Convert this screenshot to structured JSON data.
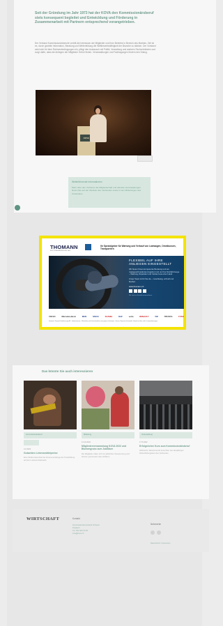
{
  "article": {
    "lead": "Seit der Gründung im Jahr 1973 hat der KOVA den Kommissionärsberuf stets konsequent begleitet und Entwicklung und Förderung in Zusammenarbeit mit Partnern entsprechend vorangetrieben.",
    "body": "Der Verband Kommissionärsberufe vertritt die Interessen der Mitglieder und ihrer Betriebe in Bereich des Marktes. Ziel ist es, durch gezielte Information, Beratung und Weiterbildung die Wettbewerbsfähigkeit der Branche zu stärken. Der Vorstand setzt sich für faire Rahmenbedingungen ein, pflegt den Austausch mit Politik, Verwaltung und anderen Fachverbänden und sorgt dafür, dass die Anliegen der Mitglieder Gehör finden. Veranstaltungen und Fachtagungen fördern den Dialog.",
    "photo_label": "KOVA",
    "info_box": {
      "title": "Weiterführende Informationen",
      "text": "Mehr über den Verband, die Mitgliedschaft und aktuelle Veranstaltungen finden Sie auf der Website des Verbandes sowie in den Mitteilungen des Vorstandes."
    }
  },
  "ad": {
    "logo": "THOMANN",
    "logo_sub": "NUTZFAHRZEUGE AG",
    "tagline": "Ihr Spezialgeber für Wartung und Verkauf von Lastwagen, Omnibussen, Transportern",
    "panel_title": "FLEXIBEL AUF IHRE ANLIEGEN EINGESTELLT",
    "panel_text": "Wir bieten Ihnen kompetente Beratung und ein massgeschneidertes Angebot rund um Ihre Nutzfahrzeuge – Wartung, Reparatur und Verkauf aus einer Hand.",
    "panel_text2": "Unser Team ist für Sie da – zuverlässig, schnell und flexibel.",
    "url": "www.thomann.ch",
    "footnote": "Wir sind ein Familienunternehmen",
    "brands": [
      "VOLVO",
      "Mercedes-Benz",
      "MAN",
      "IVECO",
      "SCANIA",
      "DAF",
      "setra",
      "RENAULT",
      "VW",
      "TRUCKS",
      "FUSO"
    ],
    "legal": "Hauptsitz: Thomann Nutzfahrzeuge AG · Industriestrasse · Werkstätten und Verkaufsstellen in der ganzen Ostschweiz · Service, Reparatur, Ersatzteile, Verkauf von Neu- und Occasionsfahrzeugen"
  },
  "related": {
    "title": "Das könnte Sie auch interessieren",
    "cards": [
      {
        "tag": "Kommissionärsberuf",
        "date": "3.2.2023",
        "headline": "Gutachten Lebensmittelpreise",
        "teaser": "Eine Studie beleuchtet die Zusammenhänge der Preisbildung auf dem Lebensmittelmarkt."
      },
      {
        "tag": "Mitteilung",
        "date": "14.10.2022",
        "headline": "Mitgliederversammlung KOVA 2022 und Blumengruss zum Jubiläum",
        "teaser": "Die Mitglieder trafen sich zur jährlichen Versammlung und feierten gemeinsam das Jubiläum."
      },
      {
        "tag": "Veranstaltung",
        "date": "17.5.2022",
        "headline": "Erfolgreicher Kurs zum Kommissionärsberuf",
        "teaser": "Zahlreiche Teilnehmende besuchten den diesjährigen Weiterbildungskurs des Verbandes."
      }
    ]
  },
  "footer": {
    "logo": "WIRTSCHAFT",
    "col1_title": "Kontakt",
    "col1_lines": [
      "Kommissionärsverband Schweiz",
      "Postfach",
      "Tel. 031 000 00 00",
      "info@kova.ch"
    ],
    "col2_title": "Netzwerke",
    "link": "Datenschutz / Impressum"
  }
}
